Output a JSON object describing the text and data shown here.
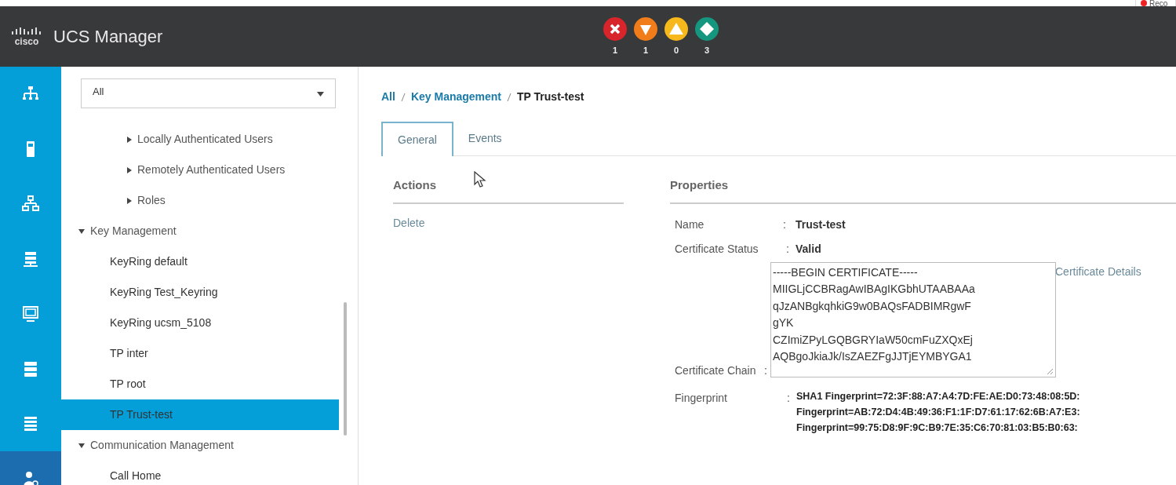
{
  "header": {
    "logo": "cisco",
    "title": "UCS Manager",
    "alarms": [
      {
        "kind": "critical",
        "count": "1"
      },
      {
        "kind": "major",
        "count": "1"
      },
      {
        "kind": "minor",
        "count": "0"
      },
      {
        "kind": "warning",
        "count": "3"
      }
    ],
    "recorder": {
      "label": "Reco"
    }
  },
  "nav_rail": [
    {
      "kind": "equipment",
      "selected": false
    },
    {
      "kind": "servers",
      "selected": false
    },
    {
      "kind": "lan",
      "selected": false
    },
    {
      "kind": "san",
      "selected": false
    },
    {
      "kind": "vm",
      "selected": false
    },
    {
      "kind": "storage",
      "selected": false
    },
    {
      "kind": "chassis",
      "selected": false
    },
    {
      "kind": "admin",
      "selected": true
    }
  ],
  "filter": {
    "value": "All"
  },
  "tree": [
    {
      "children": [
        {
          "label": "Locally Authenticated Users",
          "expanded": false,
          "selected": false
        },
        {
          "label": "Remotely Authenticated Users",
          "expanded": false,
          "selected": false
        },
        {
          "label": "Roles",
          "expanded": false,
          "selected": false
        }
      ]
    },
    {
      "label": "Key Management",
      "expanded": true,
      "selected": false,
      "children": [
        {
          "label": "KeyRing default",
          "selected": false
        },
        {
          "label": "KeyRing Test_Keyring",
          "selected": false
        },
        {
          "label": "KeyRing ucsm_5108",
          "selected": false
        },
        {
          "label": "TP inter",
          "selected": false
        },
        {
          "label": "TP root",
          "selected": false
        },
        {
          "label": "TP Trust-test",
          "selected": true
        }
      ]
    },
    {
      "label": "Communication Management",
      "expanded": true,
      "selected": false,
      "children": [
        {
          "label": "Call Home",
          "selected": false
        }
      ]
    }
  ],
  "breadcrumb": [
    "All",
    "Key Management",
    "TP Trust-test"
  ],
  "tabs": [
    {
      "label": "General",
      "selected": true
    },
    {
      "label": "Events",
      "selected": false
    }
  ],
  "actions": {
    "title": "Actions",
    "items": [
      "Delete"
    ]
  },
  "properties": {
    "title": "Properties",
    "name": {
      "label": "Name",
      "separator": ":",
      "value": "Trust-test"
    },
    "status": {
      "label": "Certificate Status",
      "separator": ":",
      "value": "Valid"
    },
    "chain": {
      "label": "Certificate Chain",
      "separator": ":",
      "value": "-----BEGIN CERTIFICATE-----\nMIIGLjCCBRagAwIBAgIKGbhUTAABAAa\nqJzANBgkqhkiG9w0BAQsFADBIMRgwF\ngYK\nCZImiZPyLGQBGRYIaW50cmFuZXQxEj\nAQBgoJkiaJk/IsZAEZFgJJTjEYMBYGA1",
      "link": "Certificate Details"
    },
    "fingerprint": {
      "label": "Fingerprint",
      "separator": ":",
      "lines": [
        "SHA1 Fingerprint=72:3F:88:A7:A4:7D:FE:AE:D0:73:48:08:5D:",
        "Fingerprint=AB:72:D4:4B:49:36:F1:1F:D7:61:17:62:6B:A7:E3:",
        "Fingerprint=99:75:D8:9F:9C:B9:7E:35:C6:70:81:03:B5:B0:63:"
      ]
    }
  }
}
